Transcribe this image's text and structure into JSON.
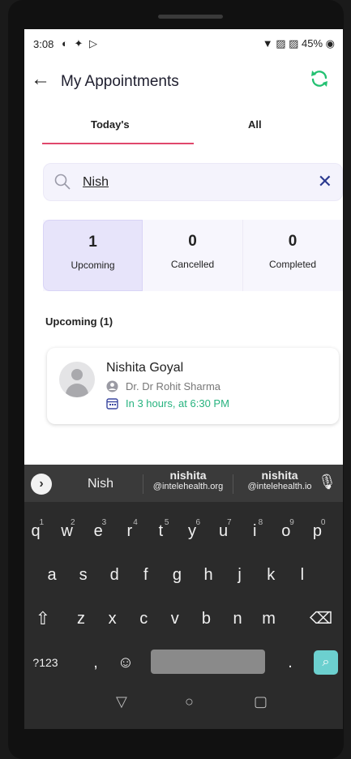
{
  "status_bar": {
    "time": "3:08",
    "notif_icons": "◐ ✦ ▷",
    "right": "▼ ▨ ▨ 45% ◉"
  },
  "header": {
    "title": "My Appointments"
  },
  "tabs": [
    {
      "label": "Today's"
    },
    {
      "label": "All"
    }
  ],
  "search": {
    "value": "Nish"
  },
  "counters": [
    {
      "count": "1",
      "label": "Upcoming"
    },
    {
      "count": "0",
      "label": "Cancelled"
    },
    {
      "count": "0",
      "label": "Completed"
    }
  ],
  "section_title": "Upcoming (1)",
  "appointment": {
    "patient": "Nishita Goyal",
    "doctor": "Dr. Dr Rohit Sharma",
    "time": "In 3 hours, at 6:30 PM"
  },
  "keyboard": {
    "suggestions": [
      {
        "word": "Nish"
      },
      {
        "word": "nishita",
        "sub": "@intelehealth.org"
      },
      {
        "word": "nishita",
        "sub": "@intelehealth.io"
      }
    ],
    "row1": [
      "q",
      "w",
      "e",
      "r",
      "t",
      "y",
      "u",
      "i",
      "o",
      "p"
    ],
    "row1_nums": [
      "1",
      "2",
      "3",
      "4",
      "5",
      "6",
      "7",
      "8",
      "9",
      "0"
    ],
    "row2": [
      "a",
      "s",
      "d",
      "f",
      "g",
      "h",
      "j",
      "k",
      "l"
    ],
    "row3": [
      "z",
      "x",
      "c",
      "v",
      "b",
      "n",
      "m"
    ],
    "symbols_key": "?123",
    "comma": ",",
    "period": "."
  },
  "colors": {
    "accent_pink": "#e0476c",
    "accent_green": "#27b37f",
    "active_card": "#e7e4fa"
  }
}
